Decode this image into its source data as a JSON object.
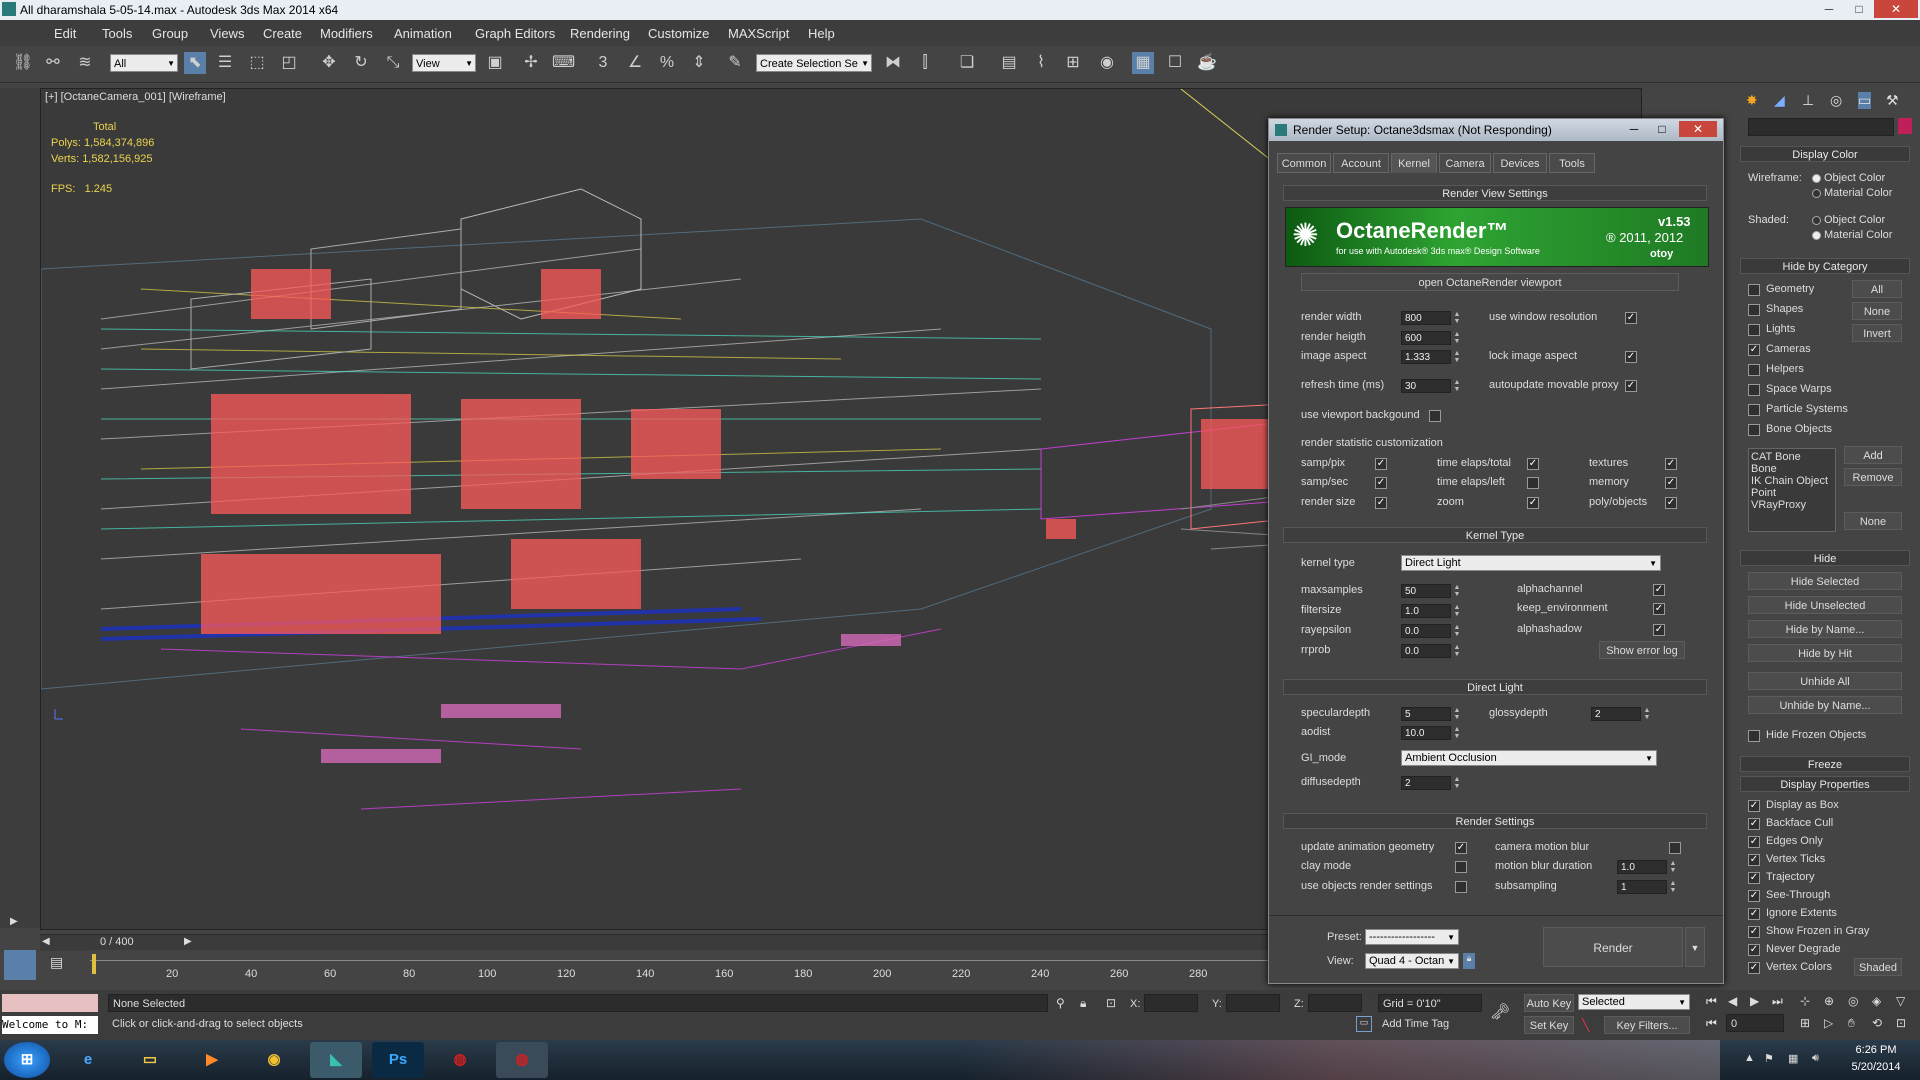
{
  "window": {
    "title": "All dharamshala 5-05-14.max - Autodesk 3ds Max  2014 x64",
    "minimize": "─",
    "maximize": "□",
    "close": "✕"
  },
  "menu": [
    "Edit",
    "Tools",
    "Group",
    "Views",
    "Create",
    "Modifiers",
    "Animation",
    "Graph Editors",
    "Rendering",
    "Customize",
    "MAXScript",
    "Help"
  ],
  "toolbar": {
    "selection_filter": "All",
    "ref_coord": "View",
    "named_selection": "Create Selection Se",
    "snap_labels": [
      "3",
      "%"
    ]
  },
  "viewport": {
    "label": "[+] [OctaneCamera_001] [Wireframe]",
    "stats_header": "Total",
    "polys_label": "Polys:",
    "polys_value": "1,584,374,896",
    "verts_label": "Verts:",
    "verts_value": "1,582,156,925",
    "fps_label": "FPS:",
    "fps_value": "1.245"
  },
  "timeline": {
    "frame": "0 / 400",
    "ticks": [
      "20",
      "40",
      "60",
      "80",
      "100",
      "120",
      "140",
      "160",
      "180",
      "200",
      "220",
      "240",
      "260",
      "280"
    ]
  },
  "status": {
    "selection": "None Selected",
    "prompt": "Click or click-and-drag to select objects",
    "welcome": "Welcome to M:",
    "x_label": "X:",
    "y_label": "Y:",
    "z_label": "Z:",
    "grid": "Grid = 0'10\"",
    "add_time_tag": "Add Time Tag",
    "auto_key": "Auto Key",
    "set_key": "Set Key",
    "key_mode": "Selected",
    "key_filters": "Key Filters...",
    "frame_field": "0"
  },
  "taskbar": {
    "apps": [
      "start",
      "ie",
      "explorer",
      "media",
      "chrome",
      "3dsmax",
      "ps",
      "gpu-z",
      "gpu-shark"
    ],
    "ps_label": "Ps",
    "time": "6:26 PM",
    "date": "5/20/2014"
  },
  "command_panel": {
    "display_color": "Display Color",
    "wireframe_label": "Wireframe:",
    "shaded_label": "Shaded:",
    "object_color": "Object Color",
    "material_color": "Material Color",
    "hide_by_category": "Hide by Category",
    "categories": [
      {
        "label": "Geometry",
        "checked": false
      },
      {
        "label": "Shapes",
        "checked": false
      },
      {
        "label": "Lights",
        "checked": false
      },
      {
        "label": "Cameras",
        "checked": true
      },
      {
        "label": "Helpers",
        "checked": false
      },
      {
        "label": "Space Warps",
        "checked": false
      },
      {
        "label": "Particle Systems",
        "checked": false
      },
      {
        "label": "Bone Objects",
        "checked": false
      }
    ],
    "all_btn": "All",
    "none_btn": "None",
    "invert_btn": "Invert",
    "list_items": [
      "CAT Bone",
      "Bone",
      "IK Chain Object",
      "Point",
      "VRayProxy"
    ],
    "add_btn": "Add",
    "remove_btn": "Remove",
    "none2_btn": "None",
    "hide": "Hide",
    "hide_buttons": [
      "Hide Selected",
      "Hide Unselected",
      "Hide by Name...",
      "Hide by Hit",
      "Unhide All",
      "Unhide by Name..."
    ],
    "hide_frozen": "Hide Frozen Objects",
    "freeze": "Freeze",
    "display_properties": "Display Properties",
    "display_props": [
      "Display as Box",
      "Backface Cull",
      "Edges Only",
      "Vertex Ticks",
      "Trajectory",
      "See-Through",
      "Ignore Extents",
      "Show Frozen in Gray",
      "Never Degrade",
      "Vertex Colors"
    ],
    "shaded_btn": "Shaded"
  },
  "dialog": {
    "title": "Render Setup: Octane3dsmax (Not Responding)",
    "tabs": [
      "Common",
      "Account",
      "Kernel",
      "Camera",
      "Devices",
      "Tools"
    ],
    "active_tab": "Kernel",
    "sec_render_view": "Render View Settings",
    "banner_title": "OctaneRender™",
    "banner_sub": "for use with Autodesk® 3ds max® Design Software",
    "banner_version": "v1.53",
    "banner_copy": "® 2011, 2012",
    "banner_brand": "otoy",
    "open_viewport": "open OctaneRender viewport",
    "render_width_label": "render width",
    "render_width": "800",
    "render_height_label": "render heigth",
    "render_height": "600",
    "image_aspect_label": "image aspect",
    "image_aspect": "1.333",
    "refresh_label": "refresh time (ms)",
    "refresh": "30",
    "use_window_res": "use window resolution",
    "lock_aspect": "lock image aspect",
    "autoupdate": "autoupdate movable proxy",
    "viewport_bg": "use viewport backgound",
    "stat_custom": "render statistic customization",
    "stats": [
      [
        "samp/pix",
        "time elaps/total",
        "textures"
      ],
      [
        "samp/sec",
        "time elaps/left",
        "memory"
      ],
      [
        "render size",
        "zoom",
        "poly/objects"
      ]
    ],
    "sec_kernel": "Kernel Type",
    "kernel_type_label": "kernel type",
    "kernel_type": "Direct Light",
    "maxsamples_label": "maxsamples",
    "maxsamples": "50",
    "filtersize_label": "filtersize",
    "filtersize": "1.0",
    "rayepsilon_label": "rayepsilon",
    "rayepsilon": "0.0",
    "rrprob_label": "rrprob",
    "rrprob": "0.0",
    "alphachannel": "alphachannel",
    "keep_env": "keep_environment",
    "alphashadow": "alphashadow",
    "show_error_log": "Show error log",
    "sec_direct": "Direct Light",
    "speculardepth_label": "speculardepth",
    "speculardepth": "5",
    "glossydepth_label": "glossydepth",
    "glossydepth": "2",
    "aodist_label": "aodist",
    "aodist": "10.0",
    "gi_mode_label": "GI_mode",
    "gi_mode": "Ambient Occlusion",
    "diffusedepth_label": "diffusedepth",
    "diffusedepth": "2",
    "sec_render_settings": "Render Settings",
    "update_anim": "update animation geometry",
    "clay_mode": "clay mode",
    "use_obj_render": "use objects render settings",
    "camera_motion_blur": "camera motion blur",
    "motion_blur_dur_label": "motion blur duration",
    "motion_blur_dur": "1.0",
    "subsampling_label": "subsampling",
    "subsampling": "1",
    "preset_label": "Preset:",
    "preset": "------------------",
    "view_label": "View:",
    "view": "Quad 4 - Octan",
    "render_btn": "Render"
  }
}
